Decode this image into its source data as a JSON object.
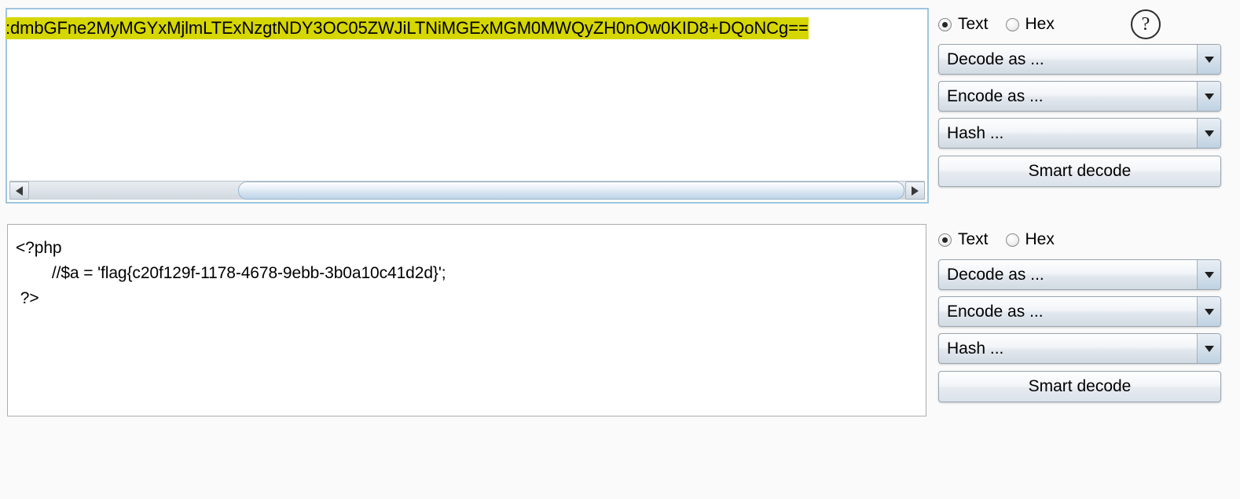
{
  "input_panel": {
    "name": "input-textarea",
    "encoded_text": ":dmbGFne2MyMGYxMjlmLTExNzgtNDY3OC05ZWJiLTNiMGExMGM0MWQyZH0nOw0KID8+DQoNCg==",
    "highlight_color": "#d6d600",
    "focus_border_color": "#9ec5e0",
    "scrollbar": {
      "left_arrow": "◀",
      "right_arrow": "▶"
    }
  },
  "output_panel": {
    "name": "output-textarea",
    "lines": [
      "<?php",
      "        //$a = 'flag{c20f129f-1178-4678-9ebb-3b0a10c41d2d}';",
      " ?>"
    ],
    "text": "<?php\n        //$a = 'flag{c20f129f-1178-4678-9ebb-3b0a10c41d2d}';\n ?>",
    "border_color": "#adadad"
  },
  "controls_top": {
    "radios": [
      {
        "label": "Text",
        "checked": true
      },
      {
        "label": "Hex",
        "checked": false
      }
    ],
    "help_label": "?",
    "dropdowns": [
      {
        "label": "Decode as ...",
        "arrow": "▼"
      },
      {
        "label": "Encode as ...",
        "arrow": "▼"
      },
      {
        "label": "Hash ...",
        "arrow": "▼"
      }
    ],
    "button_label": "Smart decode"
  },
  "controls_bottom": {
    "radios": [
      {
        "label": "Text",
        "checked": true
      },
      {
        "label": "Hex",
        "checked": false
      }
    ],
    "dropdowns": [
      {
        "label": "Decode as ...",
        "arrow": "▼"
      },
      {
        "label": "Encode as ...",
        "arrow": "▼"
      },
      {
        "label": "Hash ...",
        "arrow": "▼"
      }
    ],
    "button_label": "Smart decode"
  }
}
